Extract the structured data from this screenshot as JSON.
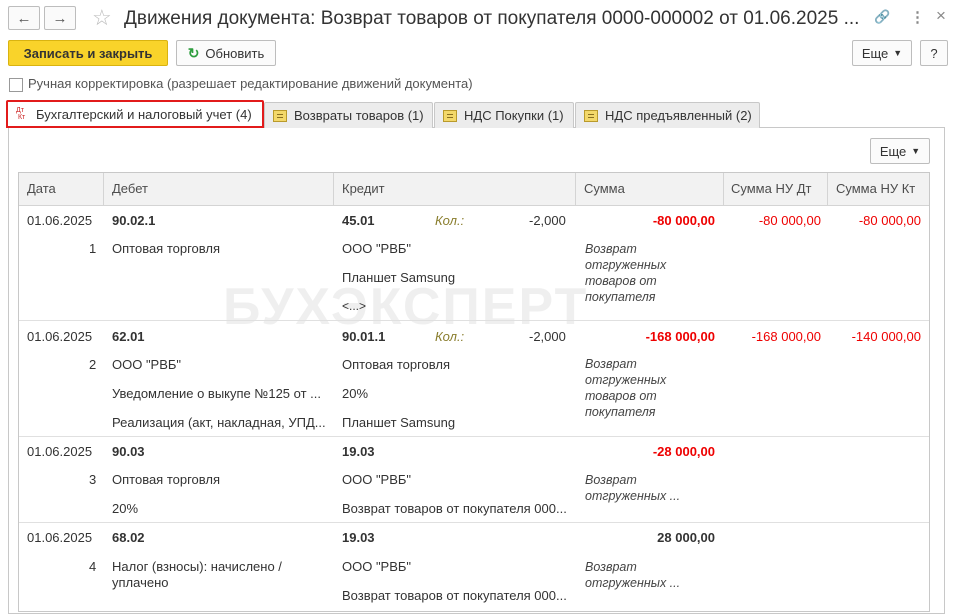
{
  "window": {
    "title": "Движения документа: Возврат товаров от покупателя 0000-000002 от 01.06.2025 ...",
    "back_icon": "←",
    "forward_icon": "→",
    "star_icon": "☆",
    "link_icon": "🔗",
    "menu_icon": "⋮",
    "close_icon": "×"
  },
  "toolbar": {
    "save_close": "Записать и закрыть",
    "refresh": "Обновить",
    "more": "Еще",
    "help": "?"
  },
  "manual_correction": {
    "label": "Ручная корректировка (разрешает редактирование движений документа)",
    "checked": false
  },
  "tabs": [
    {
      "label": "Бухгалтерский и налоговый учет (4)",
      "active": true
    },
    {
      "label": "Возвраты товаров (1)",
      "active": false
    },
    {
      "label": "НДС Покупки (1)",
      "active": false
    },
    {
      "label": "НДС предъявленный (2)",
      "active": false
    }
  ],
  "table_more": "Еще",
  "columns": {
    "date": "Дата",
    "debit": "Дебет",
    "credit": "Кредит",
    "sum": "Сумма",
    "sum_nu_dt": "Сумма НУ Дт",
    "sum_nu_kt": "Сумма НУ Кт"
  },
  "qty_label": "Кол.:",
  "rows": [
    {
      "date": "01.06.2025",
      "num": "1",
      "debit": "90.02.1",
      "debit_sub": [
        "Оптовая торговля"
      ],
      "credit": "45.01",
      "credit_qty": "-2,000",
      "credit_sub": [
        "ООО \"РВБ\"",
        "Планшет Samsung",
        "<...>"
      ],
      "sum": "-80 000,00",
      "sum_nu_dt": "-80 000,00",
      "sum_nu_kt": "-80 000,00",
      "content": "Возврат\nотгруженных\nтоваров от\nпокупателя"
    },
    {
      "date": "01.06.2025",
      "num": "2",
      "debit": "62.01",
      "debit_sub": [
        "ООО \"РВБ\"",
        "Уведомление о выкупе №125 от ...",
        "Реализация (акт, накладная, УПД..."
      ],
      "credit": "90.01.1",
      "credit_qty": "-2,000",
      "credit_sub": [
        "Оптовая торговля",
        "20%",
        "Планшет Samsung"
      ],
      "sum": "-168 000,00",
      "sum_nu_dt": "-168 000,00",
      "sum_nu_kt": "-140 000,00",
      "content": "Возврат\nотгруженных\nтоваров от\nпокупателя"
    },
    {
      "date": "01.06.2025",
      "num": "3",
      "debit": "90.03",
      "debit_sub": [
        "Оптовая торговля",
        "20%"
      ],
      "credit": "19.03",
      "credit_qty": "",
      "credit_sub": [
        "ООО \"РВБ\"",
        "Возврат товаров от покупателя 000..."
      ],
      "sum": "-28 000,00",
      "sum_nu_dt": "",
      "sum_nu_kt": "",
      "content": "Возврат\nотгруженных ..."
    },
    {
      "date": "01.06.2025",
      "num": "4",
      "debit": "68.02",
      "debit_sub": [
        "Налог (взносы): начислено /\nуплачено"
      ],
      "credit": "19.03",
      "credit_qty": "",
      "credit_sub": [
        "ООО \"РВБ\"",
        "Возврат товаров от покупателя 000..."
      ],
      "sum": "28 000,00",
      "sum_nu_dt": "",
      "sum_nu_kt": "",
      "content": "Возврат\nотгруженных ..."
    }
  ],
  "watermark": "БУХЭКСПЕРТ",
  "colors": {
    "primary_button": "#f9d32a",
    "negative": "#e00000",
    "active_tab_border": "#e21b1b"
  }
}
